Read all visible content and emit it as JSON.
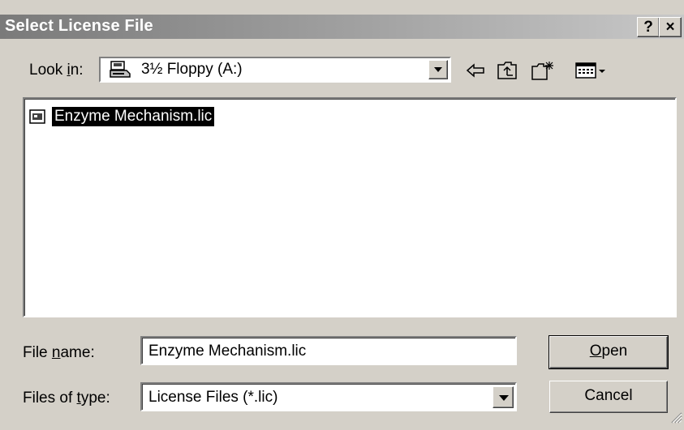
{
  "window": {
    "title": "Select License File",
    "help_label": "?",
    "close_label": "×"
  },
  "look_in": {
    "label_pre": "Look ",
    "label_accel": "i",
    "label_post": "n:",
    "value": "3½ Floppy (A:)"
  },
  "toolbar": {
    "icons": [
      "back-arrow-icon",
      "up-folder-icon",
      "new-folder-icon",
      "view-menu-icon"
    ]
  },
  "files": [
    {
      "name": "Enzyme Mechanism.lic",
      "icon": "license-file-icon",
      "selected": true
    }
  ],
  "file_name": {
    "label_pre": "File ",
    "label_accel": "n",
    "label_post": "ame:",
    "value": "Enzyme Mechanism.lic"
  },
  "file_type": {
    "label_pre": "Files of ",
    "label_accel": "t",
    "label_post": "ype:",
    "value": "License Files (*.lic)"
  },
  "buttons": {
    "open_accel": "O",
    "open_rest": "pen",
    "cancel": "Cancel"
  }
}
